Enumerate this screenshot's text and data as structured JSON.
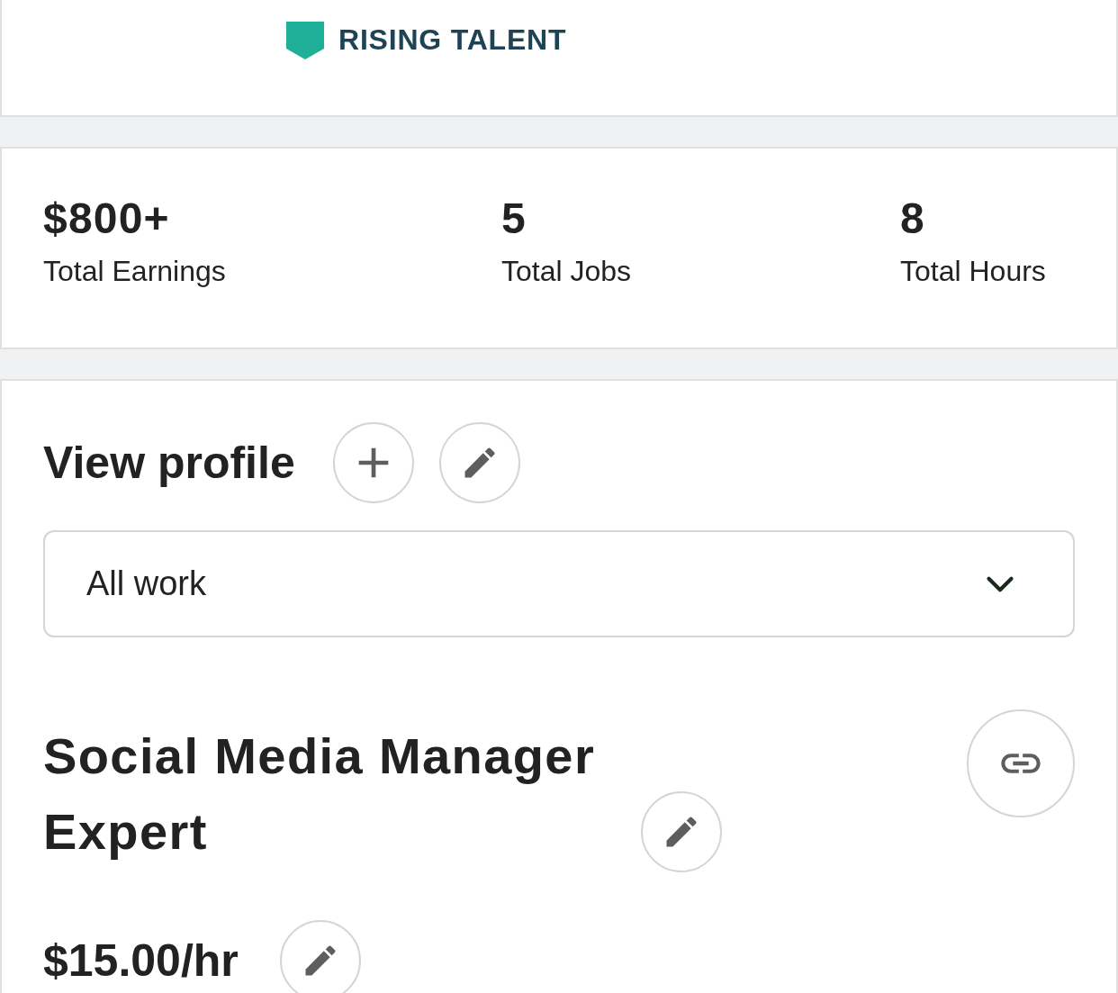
{
  "badge": {
    "label": "RISING TALENT"
  },
  "stats": [
    {
      "value": "$800+",
      "label": "Total Earnings"
    },
    {
      "value": "5",
      "label": "Total Jobs"
    },
    {
      "value": "8",
      "label": "Total Hours"
    }
  ],
  "profile": {
    "heading": "View profile",
    "dropdown": {
      "value": "All work"
    },
    "title": "Social Media Manager Expert",
    "rate": "$15.00/hr"
  }
}
